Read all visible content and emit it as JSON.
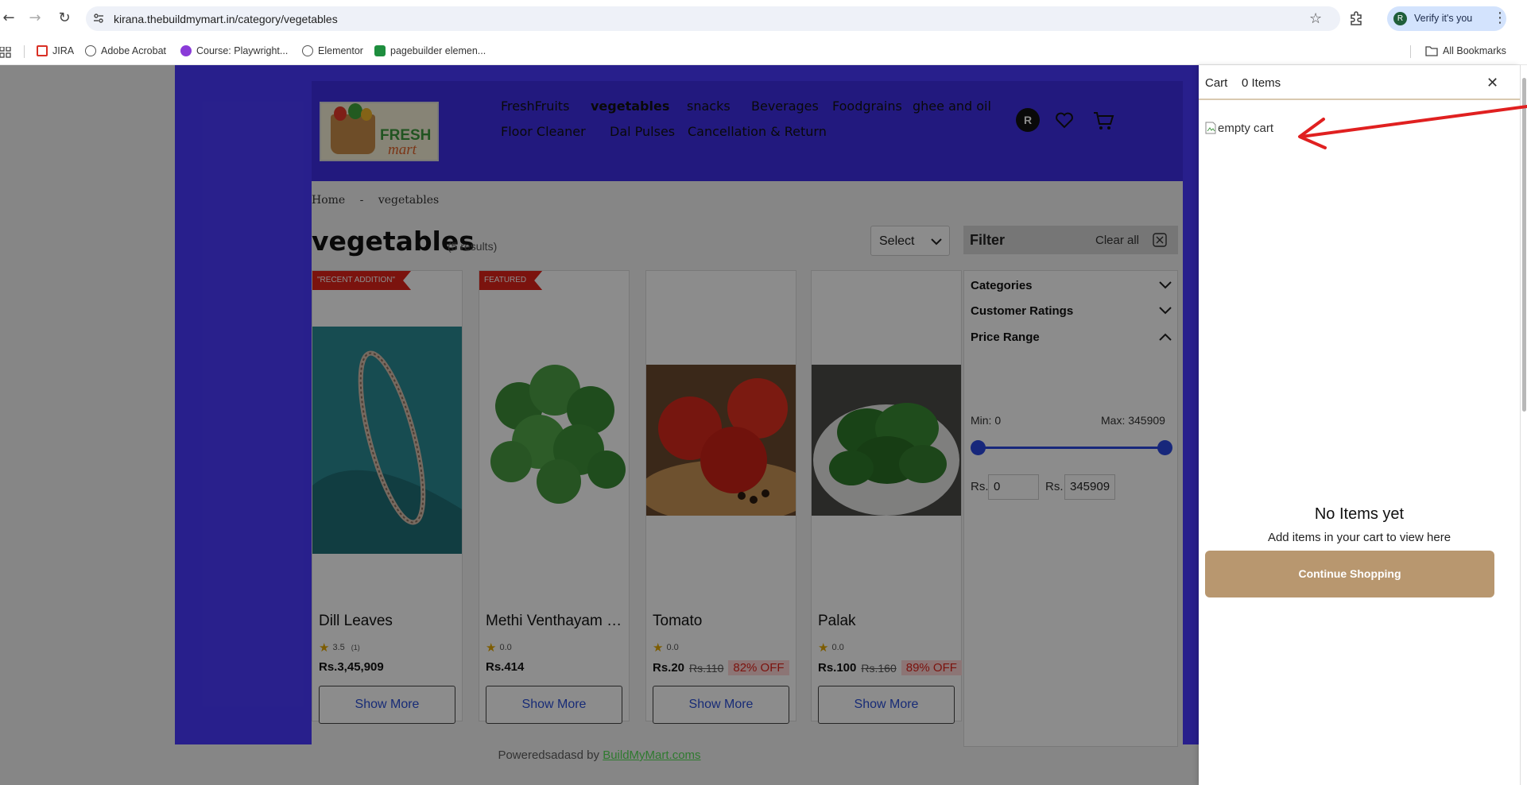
{
  "browser": {
    "url": "kirana.thebuildmymart.in/category/vegetables",
    "profile_initial": "R",
    "verify_label": "Verify it's you",
    "bookmarks": [
      {
        "label": "JIRA",
        "icon": "gmail-icon",
        "color": "#d93025"
      },
      {
        "label": "Adobe Acrobat",
        "icon": "globe-icon",
        "color": "#555555"
      },
      {
        "label": "Course: Playwright...",
        "icon": "course-icon",
        "color": "#8a3bd8"
      },
      {
        "label": "Elementor",
        "icon": "globe-icon",
        "color": "#555555"
      },
      {
        "label": "pagebuilder elemen...",
        "icon": "sheets-icon",
        "color": "#1e8e3e"
      }
    ],
    "all_bookmarks_label": "All Bookmarks"
  },
  "header": {
    "logo_line1": "FRESH",
    "logo_line2": "mart",
    "nav": [
      {
        "label": "FreshFruits",
        "active": false
      },
      {
        "label": "vegetables",
        "active": true
      },
      {
        "label": "snacks",
        "active": false
      },
      {
        "label": "Beverages",
        "active": false
      },
      {
        "label": "Foodgrains",
        "active": false
      },
      {
        "label": "ghee and oil",
        "active": false
      },
      {
        "label": "Floor Cleaner",
        "active": false
      },
      {
        "label": "Dal Pulses",
        "active": false
      },
      {
        "label": "Cancellation & Return",
        "active": false
      }
    ],
    "user_initial": "R"
  },
  "breadcrumb": {
    "home": "Home",
    "separator": "-",
    "current": "vegetables"
  },
  "listing": {
    "title": "vegetables",
    "results": "(5 results)",
    "sort_label": "Select"
  },
  "products": [
    {
      "ribbon": "\"RECENT ADDITION\"",
      "name": "Dill Leaves",
      "rating": "3.5",
      "rating_count": "(1)",
      "price": "Rs.3,45,909",
      "mrp": "",
      "off": "",
      "button": "Show More"
    },
    {
      "ribbon": "FEATURED",
      "name": "Methi Venthayam Keerai",
      "rating": "0.0",
      "rating_count": "",
      "price": "Rs.414",
      "mrp": "",
      "off": "",
      "button": "Show More"
    },
    {
      "ribbon": "",
      "name": "Tomato",
      "rating": "0.0",
      "rating_count": "",
      "price": "Rs.20",
      "mrp": "Rs.110",
      "off": "82% OFF",
      "button": "Show More"
    },
    {
      "ribbon": "",
      "name": "Palak",
      "rating": "0.0",
      "rating_count": "",
      "price": "Rs.100",
      "mrp": "Rs.160",
      "off": "89% OFF",
      "button": "Show More"
    }
  ],
  "filter": {
    "title": "Filter",
    "clear_all": "Clear all",
    "sections": [
      "Categories",
      "Customer Ratings",
      "Price Range"
    ],
    "min_label": "Min: 0",
    "max_label": "Max: 345909",
    "currency": "Rs.",
    "min_value": "0",
    "max_value": "345909"
  },
  "footer": {
    "text": "Poweredsadasd by ",
    "link": "BuildMyMart.coms"
  },
  "cart": {
    "title": "Cart",
    "count": "0 Items",
    "empty_img_alt": "empty cart",
    "empty_title": "No Items yet",
    "empty_subtitle": "Add items in your cart to view here",
    "continue_label": "Continue Shopping"
  },
  "colors": {
    "header_purple": "#3f2fe6",
    "annotation_red": "#e02020",
    "continue_button": "#b8976f",
    "offer_red": "#e0231b"
  }
}
